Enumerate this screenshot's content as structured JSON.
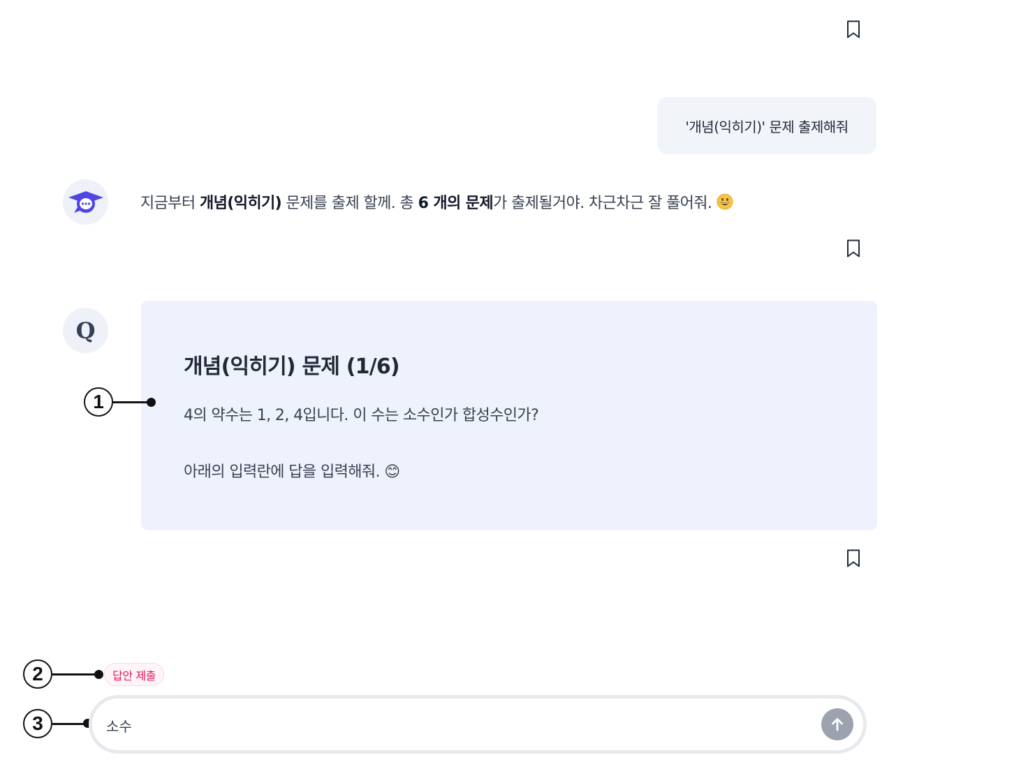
{
  "chat": {
    "user_message": "'개념(익히기)' 문제 출제해줘",
    "bot_message": {
      "part1": "지금부터 ",
      "bold1": "개념(익히기)",
      "part2": " 문제를 출제 할께. 총 ",
      "bold2": "6 개의 문제",
      "part3": "가 출제될거야. 차근차근 잘 풀어줘. "
    },
    "question": {
      "avatar_letter": "Q",
      "title": "개념(익히기) 문제 (1/6)",
      "body": "4의 약수는 1, 2, 4입니다. 이 수는 소수인가 합성수인가?",
      "instruction": "아래의 입력란에 답을 입력해줘. 😊"
    }
  },
  "annotations": {
    "marker1": "1",
    "marker2": "2",
    "marker3": "3"
  },
  "composer": {
    "submit_chip_label": "답안 제출",
    "input_value": "소수",
    "send_icon": "arrow-up-icon"
  },
  "icons": {
    "bookmark": "bookmark-icon",
    "bot_avatar": "graduation-chat-icon"
  },
  "colors": {
    "brand": "#4f46e5",
    "chip_text": "#e11d63",
    "question_bg": "#eef2fc",
    "send_button": "#9ca3af"
  }
}
